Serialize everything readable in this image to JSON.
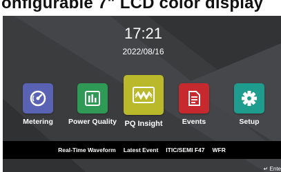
{
  "banner": {
    "text": "onfigurable 7\" LCD color display"
  },
  "clock": {
    "time": "17:21",
    "date": "2022/08/16"
  },
  "tiles": [
    {
      "label": "Metering",
      "icon": "gauge-icon",
      "color": "#5a63b3"
    },
    {
      "label": "Power Quality",
      "icon": "bar-chart-icon",
      "color": "#2f9a55"
    },
    {
      "label": "PQ Insight",
      "icon": "waveform-icon",
      "color": "#b9b92b"
    },
    {
      "label": "Events",
      "icon": "document-icon",
      "color": "#c62a2f"
    },
    {
      "label": "Setup",
      "icon": "gear-icon",
      "color": "#1e9c8e"
    }
  ],
  "quickbar": [
    "Real-Time Waveform",
    "Latest Event",
    "ITIC/SEMI F47",
    "WFR"
  ],
  "enter_hint": "↵ Ente"
}
